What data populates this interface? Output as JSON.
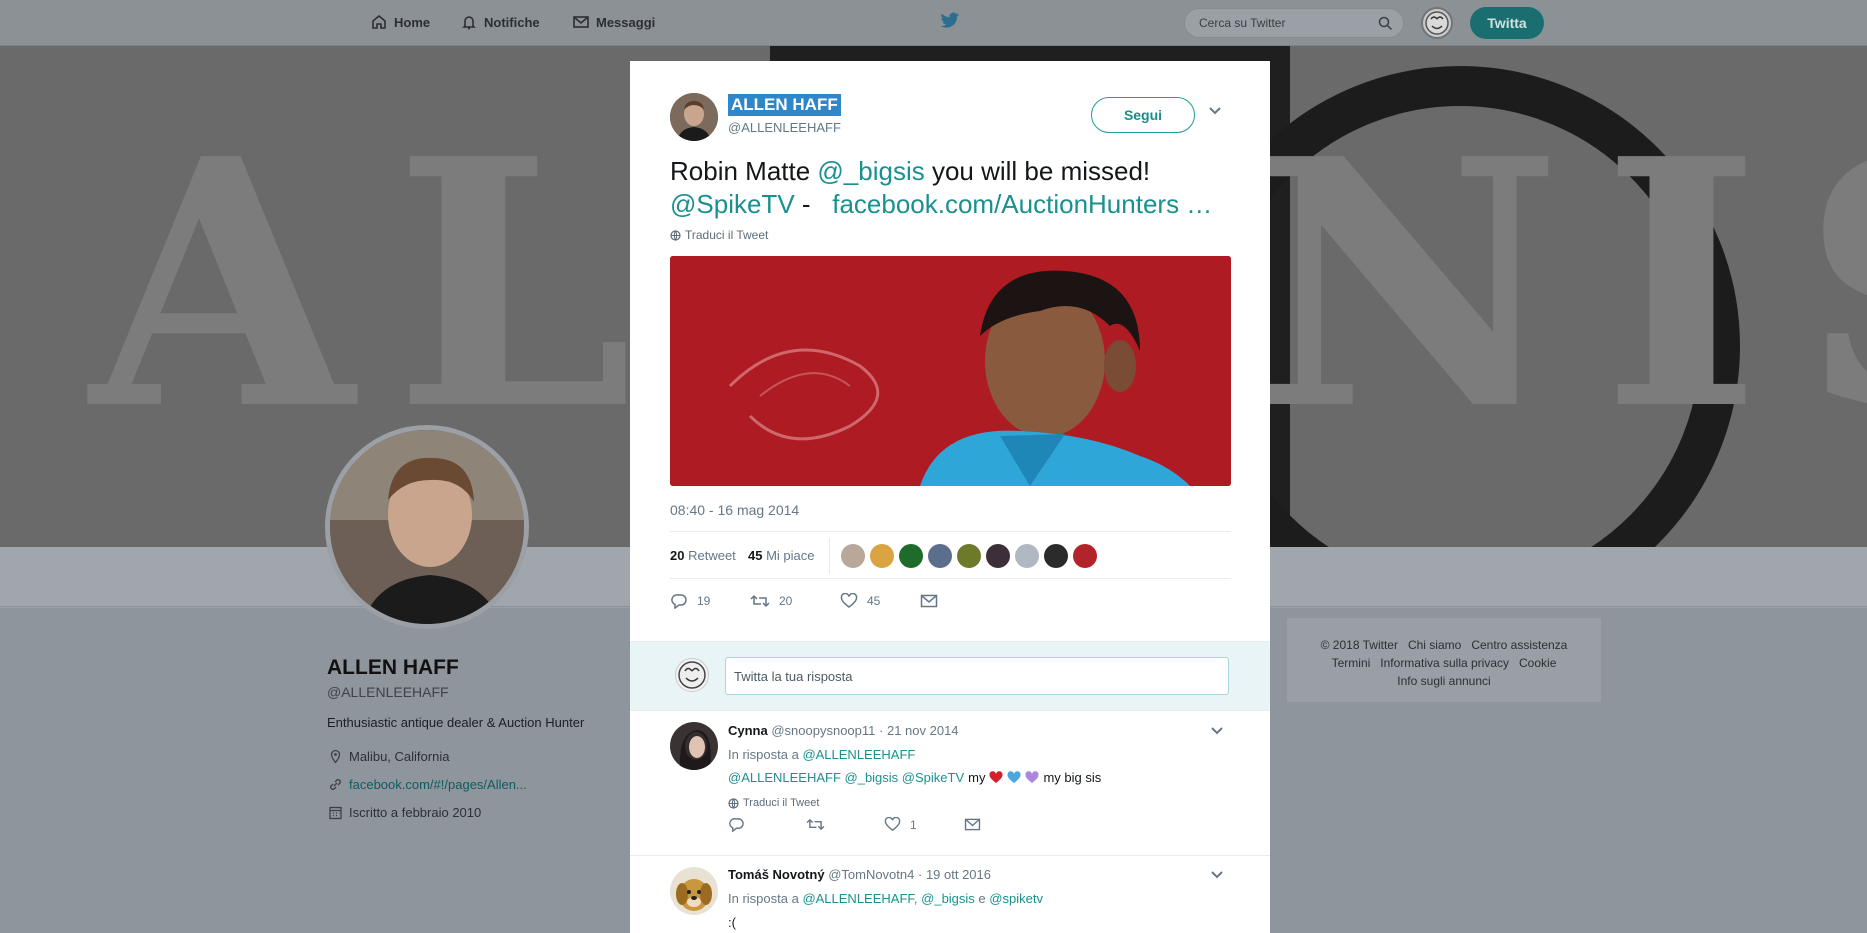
{
  "nav": {
    "home_label": "Home",
    "notifications_label": "Notifiche",
    "messages_label": "Messaggi",
    "search_placeholder": "Cerca su Twitter",
    "tweet_button_label": "Twitta"
  },
  "banner": {
    "text": "ALLENISM"
  },
  "profile": {
    "name": "ALLEN HAFF",
    "handle": "@ALLENLEEHAFF",
    "bio": "Enthusiastic antique dealer & Auction Hunter",
    "location": "Malibu, California",
    "website": "facebook.com/#!/pages/Allen...",
    "joined": "Iscritto a febbraio 2010"
  },
  "footer": {
    "links_row1": [
      "© 2018 Twitter",
      "Chi siamo",
      "Centro assistenza"
    ],
    "links_row2": [
      "Termini",
      "Informativa sulla privacy",
      "Cookie"
    ],
    "links_row3": [
      "Info sugli annunci"
    ]
  },
  "tweet": {
    "author_name": "ALLEN HAFF",
    "author_handle": "@ALLENLEEHAFF",
    "follow_label": "Segui",
    "text_part1": "Robin Matte ",
    "mention1": "@_bigsis",
    "text_part2": " you will be missed!",
    "mention2": "@SpikeTV",
    "text_part3": " -   ",
    "link": "facebook.com/AuctionHunters …",
    "translate_label": "Traduci il Tweet",
    "timestamp": "08:40 - 16 mag 2014",
    "retweets_count": "20",
    "retweets_label": "Retweet",
    "likes_count": "45",
    "likes_label": "Mi piace",
    "liker_colors": [
      "#b9a79a",
      "#d9a441",
      "#1e6b2c",
      "#5b6e8c",
      "#6c7a2a",
      "#3c2f3a",
      "#b0b8c2",
      "#2b2b2b",
      "#b3232a"
    ],
    "actions": {
      "replies": "19",
      "retweets": "20",
      "likes": "45"
    }
  },
  "reply_box": {
    "placeholder": "Twitta la tua risposta"
  },
  "replies": [
    {
      "name": "Cynna",
      "handle": "@snoopysnoop11",
      "date": "· 21 nov 2014",
      "in_reply_prefix": "In risposta a ",
      "in_reply_to": "@ALLENLEEHAFF",
      "mentions": "@ALLENLEEHAFF @_bigsis @SpikeTV",
      "text_my": "my",
      "text_end": "my big sis",
      "translate_label": "Traduci il Tweet",
      "likes": "1"
    },
    {
      "name": "Tomáš Novotný",
      "handle": "@TomNovotn4",
      "date": "· 19 ott 2016",
      "in_reply_prefix": "In risposta a ",
      "in_reply_to_1": "@ALLENLEEHAFF",
      "sep1": ", ",
      "in_reply_to_2": "@_bigsis",
      "sep2": " e ",
      "in_reply_to_3": "@spiketv",
      "text": ":("
    }
  ]
}
